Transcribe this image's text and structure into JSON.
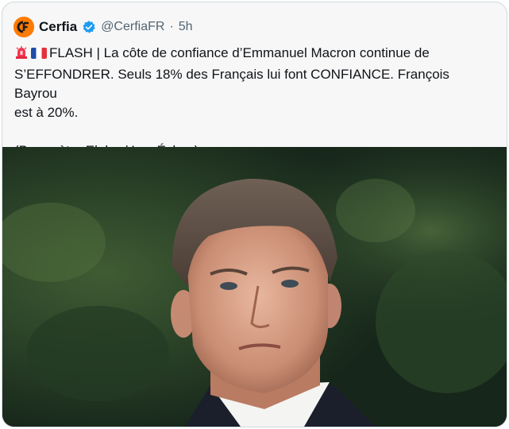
{
  "tweet": {
    "account_name": "Cerfia",
    "handle": "@CerfiaFR",
    "separator": "·",
    "time": "5h",
    "text_line1": "FLASH | La côte de confiance d’Emmanuel Macron continue de",
    "text_line2": "S’EFFONDRER. Seuls 18% des Français lui font CONFIANCE. François Bayrou",
    "text_line3": "est à 20%.",
    "text_source": "(Baromètre Elabe / Les Échos)",
    "avatar_icon": "cerfia-logo-icon",
    "verified_icon": "verified-badge-icon",
    "emoji_icons": [
      "rotating-light-icon",
      "france-flag-icon"
    ]
  },
  "colors": {
    "card_background": "#f7f7f7",
    "border": "#cfd9de",
    "text": "#0f1419",
    "muted_text": "#536471",
    "verified_blue": "#1d9bf0",
    "avatar_orange": "#ff7a00"
  }
}
